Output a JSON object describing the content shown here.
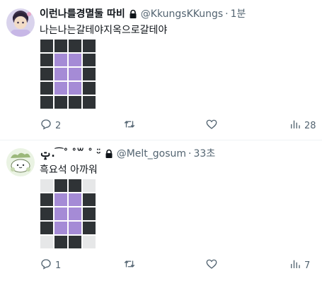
{
  "colors": {
    "dark_cell": "#2f3336",
    "purple_cell": "#a58bd6",
    "light_cell": "#e6e7e8",
    "muted_text": "#536471"
  },
  "tweets": [
    {
      "name": "이런나를경멸둘 따비",
      "handle": "@KkungsKKungs",
      "dot": "·",
      "time": "1분",
      "text": "나는나는갈테야지옥으로갈테야",
      "grid": [
        [
          "D",
          "D",
          "D",
          "D"
        ],
        [
          "D",
          "P",
          "P",
          "D"
        ],
        [
          "D",
          "P",
          "P",
          "D"
        ],
        [
          "D",
          "P",
          "P",
          "D"
        ],
        [
          "D",
          "D",
          "D",
          "D"
        ]
      ],
      "replies": "2",
      "retweets": "",
      "likes": "",
      "views": "28"
    },
    {
      "name": "ݓ.⁀˚ ˚꒳ ˚ ᵕ̈",
      "handle": "@Melt_gosum",
      "dot": "·",
      "time": "33초",
      "text": "흑요석 아까워",
      "grid": [
        [
          "L",
          "D",
          "D",
          "L"
        ],
        [
          "D",
          "P",
          "P",
          "D"
        ],
        [
          "D",
          "P",
          "P",
          "D"
        ],
        [
          "D",
          "P",
          "P",
          "D"
        ],
        [
          "L",
          "D",
          "D",
          "L"
        ]
      ],
      "replies": "1",
      "retweets": "",
      "likes": "",
      "views": "7"
    }
  ]
}
